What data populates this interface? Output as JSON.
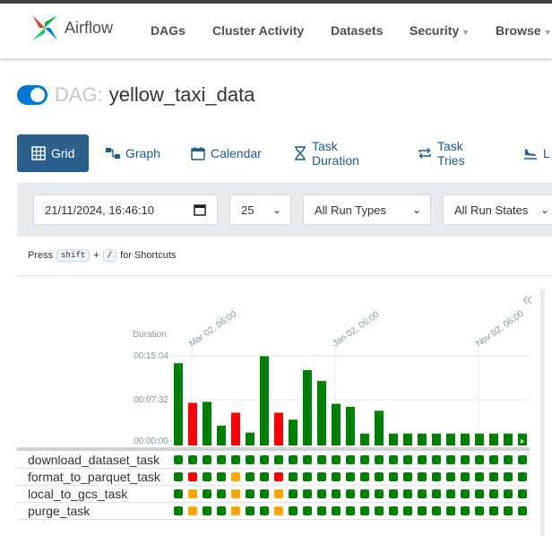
{
  "brand": {
    "name": "Airflow"
  },
  "nav": {
    "dags": "DAGs",
    "cluster_activity": "Cluster Activity",
    "datasets": "Datasets",
    "security": "Security",
    "browse": "Browse"
  },
  "dag": {
    "prefix": "DAG:",
    "name": "yellow_taxi_data",
    "active": true
  },
  "tabs": {
    "grid": "Grid",
    "graph": "Graph",
    "calendar": "Calendar",
    "task_duration": "Task Duration",
    "task_tries": "Task Tries",
    "landing": "L"
  },
  "filters": {
    "datetime": "21/11/2024, 16:46:10",
    "num_runs": "25",
    "run_types": "All Run Types",
    "run_states": "All Run States"
  },
  "shortcuts": {
    "press": "Press",
    "shift": "shift",
    "plus": "+",
    "slash": "/",
    "suffix": "for Shortcuts"
  },
  "grid": {
    "duration_label": "Duration",
    "y_ticks": [
      "00:15:04",
      "00:07:32",
      "00:00:00"
    ],
    "date_labels": [
      "Mar 02, 06:00",
      "Jan 02, 06:00",
      "Nov 02, 06:00"
    ],
    "tasks": [
      "download_dataset_task",
      "format_to_parquet_task",
      "local_to_gcs_task",
      "purge_task"
    ]
  },
  "colors": {
    "success": "#008000",
    "failed": "#ff0000",
    "upstream_failed": "#ffa500",
    "link": "#1e5c8c",
    "active_tab": "#2b5f8c"
  },
  "chart_data": {
    "type": "bar",
    "ylabel": "Duration",
    "y_ticks": [
      "00:15:04",
      "00:07:32",
      "00:00:00"
    ],
    "ylim": [
      0,
      904
    ],
    "values": [
      830,
      430,
      440,
      200,
      330,
      130,
      900,
      330,
      260,
      760,
      650,
      420,
      390,
      120,
      350,
      120,
      120,
      120,
      120,
      120,
      120,
      120,
      120,
      120,
      120
    ],
    "run_states": [
      "success",
      "failed",
      "success",
      "success",
      "failed",
      "success",
      "success",
      "failed",
      "success",
      "success",
      "success",
      "success",
      "success",
      "success",
      "success",
      "success",
      "success",
      "success",
      "success",
      "success",
      "success",
      "success",
      "success",
      "success",
      "success"
    ],
    "task_states": {
      "download_dataset_task": [
        "success",
        "success",
        "success",
        "success",
        "success",
        "success",
        "success",
        "success",
        "success",
        "success",
        "success",
        "success",
        "success",
        "success",
        "success",
        "success",
        "success",
        "success",
        "success",
        "success",
        "success",
        "success",
        "success",
        "success",
        "success"
      ],
      "format_to_parquet_task": [
        "success",
        "failed",
        "success",
        "success",
        "upstream_failed",
        "success",
        "success",
        "failed",
        "success",
        "success",
        "success",
        "success",
        "success",
        "success",
        "success",
        "success",
        "success",
        "success",
        "success",
        "success",
        "success",
        "success",
        "success",
        "success",
        "success"
      ],
      "local_to_gcs_task": [
        "success",
        "upstream_failed",
        "success",
        "success",
        "upstream_failed",
        "success",
        "success",
        "upstream_failed",
        "success",
        "success",
        "success",
        "success",
        "success",
        "success",
        "success",
        "success",
        "success",
        "success",
        "success",
        "success",
        "success",
        "success",
        "success",
        "success",
        "success"
      ],
      "purge_task": [
        "success",
        "upstream_failed",
        "success",
        "success",
        "upstream_failed",
        "success",
        "success",
        "upstream_failed",
        "success",
        "success",
        "success",
        "success",
        "success",
        "success",
        "success",
        "success",
        "success",
        "success",
        "success",
        "success",
        "success",
        "success",
        "success",
        "success",
        "success"
      ]
    }
  }
}
